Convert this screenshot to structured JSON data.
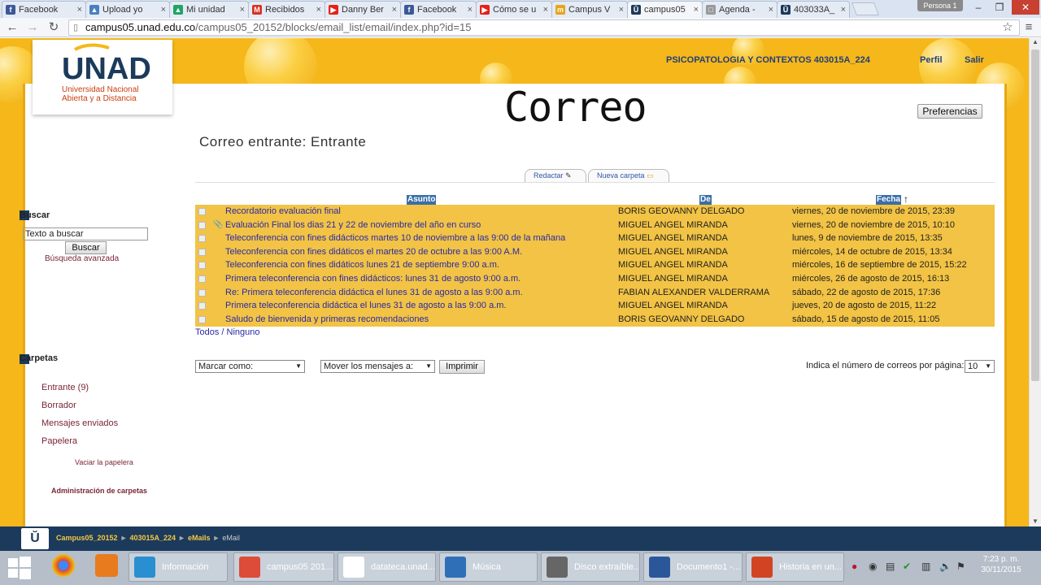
{
  "browser": {
    "tabs": [
      {
        "label": "Facebook",
        "color": "#3b5998",
        "glyph": "f"
      },
      {
        "label": "Upload yo",
        "color": "#4a7fc1",
        "glyph": "▲"
      },
      {
        "label": "Mi unidad",
        "color": "#1fa463",
        "glyph": "▲"
      },
      {
        "label": "Recibidos",
        "color": "#d93025",
        "glyph": "M"
      },
      {
        "label": "Danny Ber",
        "color": "#e62117",
        "glyph": "▶"
      },
      {
        "label": "Facebook",
        "color": "#3b5998",
        "glyph": "f"
      },
      {
        "label": "Cómo se u",
        "color": "#e62117",
        "glyph": "▶"
      },
      {
        "label": "Campus V",
        "color": "#e8a317",
        "glyph": "m"
      },
      {
        "label": "campus05",
        "color": "#1b3a5c",
        "glyph": "Ŭ",
        "active": true
      },
      {
        "label": "Agenda - ",
        "color": "#999999",
        "glyph": "□"
      },
      {
        "label": "403033A_",
        "color": "#1b3a5c",
        "glyph": "Ŭ"
      }
    ],
    "persona": "Persona 1",
    "url_host": "campus05.unad.edu.co",
    "url_path": "/campus05_20152/blocks/email_list/email/index.php?id=15"
  },
  "header": {
    "logo_text": "UNAD",
    "logo_sub1": "Universidad Nacional",
    "logo_sub2": "Abierta y a  Distancia",
    "course": "PSICOPATOLOGIA Y CONTEXTOS 403015A_224",
    "profile": "Perfil",
    "logout": "Salir",
    "overlay_title": "Correo",
    "preferences": "Preferencias"
  },
  "main": {
    "heading": "Correo entrante: Entrante",
    "compose": "Redactar",
    "new_folder": "Nueva carpeta",
    "col_subject": "Asunto",
    "col_from": "De",
    "col_date": "Fecha",
    "messages": [
      {
        "subject": "Recordatorio evaluación final",
        "from": "BORIS GEOVANNY DELGADO",
        "date": "viernes, 20 de noviembre de 2015, 23:39",
        "attachment": false
      },
      {
        "subject": "Evaluación Final los dias 21 y 22 de noviembre del año en curso",
        "from": "MIGUEL ANGEL MIRANDA",
        "date": "viernes, 20 de noviembre de 2015, 10:10",
        "attachment": true
      },
      {
        "subject": "Teleconferencia con fines didácticos martes 10 de noviembre a las 9:00 de la mañana",
        "from": "MIGUEL ANGEL MIRANDA",
        "date": "lunes, 9 de noviembre de 2015, 13:35",
        "attachment": false
      },
      {
        "subject": "Teleconferencia con fines didáticos el martes 20 de octubre a las 9:00 A.M.",
        "from": "MIGUEL ANGEL MIRANDA",
        "date": "miércoles, 14 de octubre de 2015, 13:34",
        "attachment": false
      },
      {
        "subject": "Teleconferencia con fines didáticos lunes 21 de septiembre 9:00 a.m.",
        "from": "MIGUEL ANGEL MIRANDA",
        "date": "miércoles, 16 de septiembre de 2015, 15:22",
        "attachment": false
      },
      {
        "subject": "Primera teleconferencia con fines didácticos: lunes 31 de agosto 9:00 a.m.",
        "from": "MIGUEL ANGEL MIRANDA",
        "date": "miércoles, 26 de agosto de 2015, 16:13",
        "attachment": false
      },
      {
        "subject": "Re: Primera teleconferencia didáctica el lunes 31 de agosto a las 9:00 a.m.",
        "from": "FABIAN ALEXANDER VALDERRAMA",
        "date": "sábado, 22 de agosto de 2015, 17:36",
        "attachment": false
      },
      {
        "subject": "Primera teleconferencia didáctica el lunes 31 de agosto a las 9:00 a.m.",
        "from": "MIGUEL ANGEL MIRANDA",
        "date": "jueves, 20 de agosto de 2015, 11:22",
        "attachment": false
      },
      {
        "subject": "Saludo de bienvenida y primeras recomendaciones",
        "from": "BORIS GEOVANNY DELGADO",
        "date": "sábado, 15 de agosto de 2015, 11:05",
        "attachment": false
      }
    ],
    "select_all": "Todos",
    "select_none": "Ninguno",
    "mark_as": "Marcar como:",
    "move_to": "Mover los mensajes a:",
    "print": "Imprimir",
    "per_page_label": "Indica el número de correos por página:",
    "per_page_value": "10"
  },
  "sidebar": {
    "search_title": "Buscar",
    "search_placeholder": "Texto a buscar",
    "search_button": "Buscar",
    "advanced": "Búsqueda avanzada",
    "folders_title": "Carpetas",
    "inbox": "Entrante",
    "inbox_count": "(9)",
    "drafts": "Borrador",
    "sent": "Mensajes enviados",
    "trash": "Papelera",
    "empty_trash": "Vaciar la papelera",
    "manage": "Administración de carpetas"
  },
  "footer": {
    "crumbs": [
      "Campus05_20152",
      "403015A_224",
      "eMails",
      "eMail"
    ]
  },
  "taskbar": {
    "items": [
      {
        "label": "Información",
        "color": "#2a8fd0"
      },
      {
        "label": "campus05 201...",
        "color": "#dd4b39"
      },
      {
        "label": "datateca.unad...",
        "color": "#ffffff"
      },
      {
        "label": "Música",
        "color": "#2f6fb8"
      },
      {
        "label": "Disco extraíble...",
        "color": "#666666"
      },
      {
        "label": "Documento1 -...",
        "color": "#2b579a"
      },
      {
        "label": "Historia en un...",
        "color": "#d04423"
      }
    ],
    "time": "7:23 p. m.",
    "date": "30/11/2015"
  }
}
